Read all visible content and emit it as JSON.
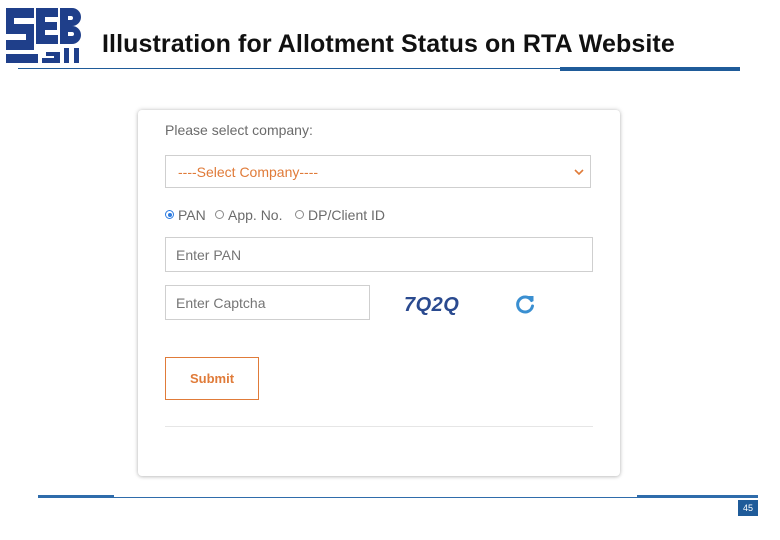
{
  "slide": {
    "title": "Illustration for Allotment Status on RTA Website",
    "page_number": "45",
    "accent_color": "#1f5b99"
  },
  "logo": {
    "name": "SEBI logo",
    "text": "SEBI"
  },
  "form": {
    "company_label": "Please select company:",
    "company_select": {
      "selected": "----Select Company----",
      "icon": "chevron-down-icon"
    },
    "id_type_options": [
      {
        "label": "PAN",
        "checked": true
      },
      {
        "label": "App. No.",
        "checked": false
      },
      {
        "label": "DP/Client ID",
        "checked": false
      }
    ],
    "pan_input": {
      "placeholder": "Enter PAN",
      "value": ""
    },
    "captcha_input": {
      "placeholder": "Enter Captcha",
      "value": ""
    },
    "captcha_code": "7Q2Q",
    "refresh_icon": "refresh-icon",
    "submit_label": "Submit",
    "accent_color": "#e07b39"
  }
}
